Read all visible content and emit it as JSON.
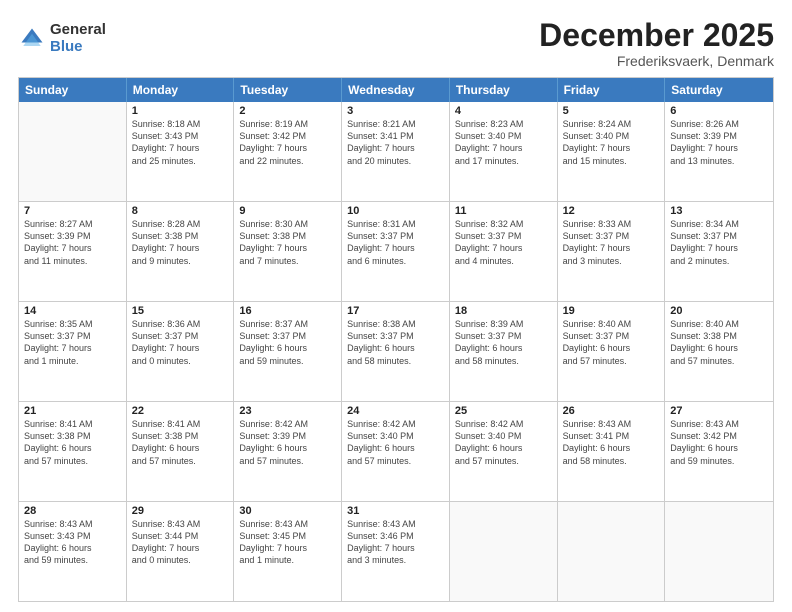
{
  "header": {
    "logo_general": "General",
    "logo_blue": "Blue",
    "title": "December 2025",
    "location": "Frederiksvaerk, Denmark"
  },
  "weekdays": [
    "Sunday",
    "Monday",
    "Tuesday",
    "Wednesday",
    "Thursday",
    "Friday",
    "Saturday"
  ],
  "rows": [
    [
      {
        "day": "",
        "lines": []
      },
      {
        "day": "1",
        "lines": [
          "Sunrise: 8:18 AM",
          "Sunset: 3:43 PM",
          "Daylight: 7 hours",
          "and 25 minutes."
        ]
      },
      {
        "day": "2",
        "lines": [
          "Sunrise: 8:19 AM",
          "Sunset: 3:42 PM",
          "Daylight: 7 hours",
          "and 22 minutes."
        ]
      },
      {
        "day": "3",
        "lines": [
          "Sunrise: 8:21 AM",
          "Sunset: 3:41 PM",
          "Daylight: 7 hours",
          "and 20 minutes."
        ]
      },
      {
        "day": "4",
        "lines": [
          "Sunrise: 8:23 AM",
          "Sunset: 3:40 PM",
          "Daylight: 7 hours",
          "and 17 minutes."
        ]
      },
      {
        "day": "5",
        "lines": [
          "Sunrise: 8:24 AM",
          "Sunset: 3:40 PM",
          "Daylight: 7 hours",
          "and 15 minutes."
        ]
      },
      {
        "day": "6",
        "lines": [
          "Sunrise: 8:26 AM",
          "Sunset: 3:39 PM",
          "Daylight: 7 hours",
          "and 13 minutes."
        ]
      }
    ],
    [
      {
        "day": "7",
        "lines": [
          "Sunrise: 8:27 AM",
          "Sunset: 3:39 PM",
          "Daylight: 7 hours",
          "and 11 minutes."
        ]
      },
      {
        "day": "8",
        "lines": [
          "Sunrise: 8:28 AM",
          "Sunset: 3:38 PM",
          "Daylight: 7 hours",
          "and 9 minutes."
        ]
      },
      {
        "day": "9",
        "lines": [
          "Sunrise: 8:30 AM",
          "Sunset: 3:38 PM",
          "Daylight: 7 hours",
          "and 7 minutes."
        ]
      },
      {
        "day": "10",
        "lines": [
          "Sunrise: 8:31 AM",
          "Sunset: 3:37 PM",
          "Daylight: 7 hours",
          "and 6 minutes."
        ]
      },
      {
        "day": "11",
        "lines": [
          "Sunrise: 8:32 AM",
          "Sunset: 3:37 PM",
          "Daylight: 7 hours",
          "and 4 minutes."
        ]
      },
      {
        "day": "12",
        "lines": [
          "Sunrise: 8:33 AM",
          "Sunset: 3:37 PM",
          "Daylight: 7 hours",
          "and 3 minutes."
        ]
      },
      {
        "day": "13",
        "lines": [
          "Sunrise: 8:34 AM",
          "Sunset: 3:37 PM",
          "Daylight: 7 hours",
          "and 2 minutes."
        ]
      }
    ],
    [
      {
        "day": "14",
        "lines": [
          "Sunrise: 8:35 AM",
          "Sunset: 3:37 PM",
          "Daylight: 7 hours",
          "and 1 minute."
        ]
      },
      {
        "day": "15",
        "lines": [
          "Sunrise: 8:36 AM",
          "Sunset: 3:37 PM",
          "Daylight: 7 hours",
          "and 0 minutes."
        ]
      },
      {
        "day": "16",
        "lines": [
          "Sunrise: 8:37 AM",
          "Sunset: 3:37 PM",
          "Daylight: 6 hours",
          "and 59 minutes."
        ]
      },
      {
        "day": "17",
        "lines": [
          "Sunrise: 8:38 AM",
          "Sunset: 3:37 PM",
          "Daylight: 6 hours",
          "and 58 minutes."
        ]
      },
      {
        "day": "18",
        "lines": [
          "Sunrise: 8:39 AM",
          "Sunset: 3:37 PM",
          "Daylight: 6 hours",
          "and 58 minutes."
        ]
      },
      {
        "day": "19",
        "lines": [
          "Sunrise: 8:40 AM",
          "Sunset: 3:37 PM",
          "Daylight: 6 hours",
          "and 57 minutes."
        ]
      },
      {
        "day": "20",
        "lines": [
          "Sunrise: 8:40 AM",
          "Sunset: 3:38 PM",
          "Daylight: 6 hours",
          "and 57 minutes."
        ]
      }
    ],
    [
      {
        "day": "21",
        "lines": [
          "Sunrise: 8:41 AM",
          "Sunset: 3:38 PM",
          "Daylight: 6 hours",
          "and 57 minutes."
        ]
      },
      {
        "day": "22",
        "lines": [
          "Sunrise: 8:41 AM",
          "Sunset: 3:38 PM",
          "Daylight: 6 hours",
          "and 57 minutes."
        ]
      },
      {
        "day": "23",
        "lines": [
          "Sunrise: 8:42 AM",
          "Sunset: 3:39 PM",
          "Daylight: 6 hours",
          "and 57 minutes."
        ]
      },
      {
        "day": "24",
        "lines": [
          "Sunrise: 8:42 AM",
          "Sunset: 3:40 PM",
          "Daylight: 6 hours",
          "and 57 minutes."
        ]
      },
      {
        "day": "25",
        "lines": [
          "Sunrise: 8:42 AM",
          "Sunset: 3:40 PM",
          "Daylight: 6 hours",
          "and 57 minutes."
        ]
      },
      {
        "day": "26",
        "lines": [
          "Sunrise: 8:43 AM",
          "Sunset: 3:41 PM",
          "Daylight: 6 hours",
          "and 58 minutes."
        ]
      },
      {
        "day": "27",
        "lines": [
          "Sunrise: 8:43 AM",
          "Sunset: 3:42 PM",
          "Daylight: 6 hours",
          "and 59 minutes."
        ]
      }
    ],
    [
      {
        "day": "28",
        "lines": [
          "Sunrise: 8:43 AM",
          "Sunset: 3:43 PM",
          "Daylight: 6 hours",
          "and 59 minutes."
        ]
      },
      {
        "day": "29",
        "lines": [
          "Sunrise: 8:43 AM",
          "Sunset: 3:44 PM",
          "Daylight: 7 hours",
          "and 0 minutes."
        ]
      },
      {
        "day": "30",
        "lines": [
          "Sunrise: 8:43 AM",
          "Sunset: 3:45 PM",
          "Daylight: 7 hours",
          "and 1 minute."
        ]
      },
      {
        "day": "31",
        "lines": [
          "Sunrise: 8:43 AM",
          "Sunset: 3:46 PM",
          "Daylight: 7 hours",
          "and 3 minutes."
        ]
      },
      {
        "day": "",
        "lines": []
      },
      {
        "day": "",
        "lines": []
      },
      {
        "day": "",
        "lines": []
      }
    ]
  ]
}
